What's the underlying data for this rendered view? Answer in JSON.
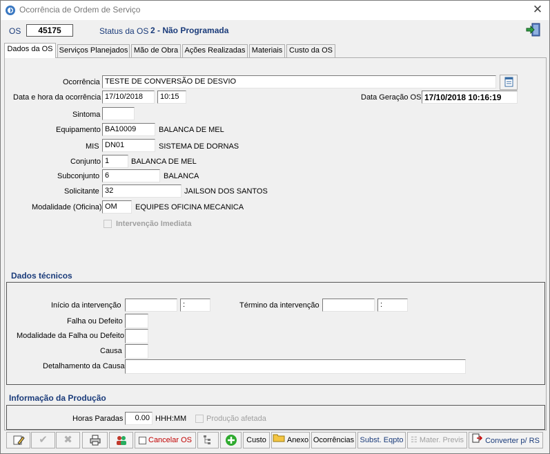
{
  "window": {
    "title": "Ocorrência de Ordem de Serviço"
  },
  "header": {
    "os_label": "OS",
    "os_number": "45175",
    "status_label": "Status da OS",
    "status_value": "2 - Não Programada"
  },
  "tabs": [
    "Dados da OS",
    "Serviços Planejados",
    "Mão de Obra",
    "Ações Realizadas",
    "Materiais",
    "Custo da OS"
  ],
  "form": {
    "ocorrencia_label": "Ocorrência",
    "ocorrencia_value": "TESTE DE CONVERSÃO DE DESVIO",
    "data_hora_label": "Data e hora da ocorrência",
    "data_value": "17/10/2018",
    "hora_value": "10:15",
    "data_geracao_label": "Data Geração OS",
    "data_geracao_value": "17/10/2018 10:16:19",
    "sintoma_label": "Sintoma",
    "sintoma_value": "",
    "equipamento_label": "Equipamento",
    "equipamento_code": "BA10009",
    "equipamento_desc": "BALANCA DE MEL",
    "mis_label": "MIS",
    "mis_code": "DN01",
    "mis_desc": "SISTEMA DE DORNAS",
    "conjunto_label": "Conjunto",
    "conjunto_code": "1",
    "conjunto_desc": "BALANCA DE MEL",
    "subconjunto_label": "Subconjunto",
    "subconjunto_code": "6",
    "subconjunto_desc": "BALANCA",
    "solicitante_label": "Solicitante",
    "solicitante_code": "32",
    "solicitante_desc": "JAILSON DOS SANTOS",
    "modalidade_label": "Modalidade (Oficina)",
    "modalidade_code": "OM",
    "modalidade_desc": "EQUIPES OFICINA MECANICA",
    "intervencao_label": "Intervenção Imediata"
  },
  "dados_tecnicos": {
    "title": "Dados técnicos",
    "inicio_label": "Início da intervenção",
    "inicio_date": "",
    "inicio_time": " :",
    "termino_label": "Término da intervenção",
    "termino_date": "",
    "termino_time": " :",
    "falha_label": "Falha ou Defeito",
    "modalidade_falha_label": "Modalidade da Falha ou Defeito",
    "causa_label": "Causa",
    "detalhamento_label": "Detalhamento da Causa"
  },
  "producao": {
    "title": "Informação da Produção",
    "horas_label": "Horas Paradas",
    "horas_value": "0.00",
    "horas_unit": "HHH:MM",
    "afetada_label": "Produção afetada"
  },
  "toolbar": {
    "cancelar_label": "Cancelar OS",
    "custo_label": "Custo",
    "anexo_label": "Anexo",
    "ocorrencias_label": "Ocorrências",
    "subst_label": "Subst. Eqpto",
    "mater_label": "Mater. Previs",
    "converter_label": "Converter p/ RS"
  },
  "colors": {
    "accent": "#1a3b7a",
    "cancel": "#c00000",
    "add": "#2eaa2e"
  }
}
